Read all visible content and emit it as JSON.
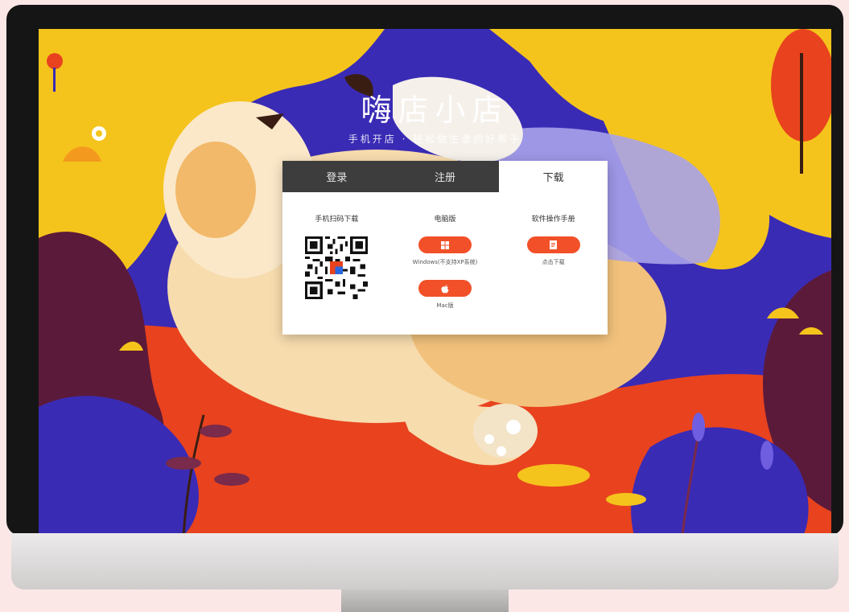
{
  "header": {
    "brand": "嗨店小店",
    "slogan": "手机开店 · 轻松做生意的好帮手"
  },
  "tabs": [
    {
      "label": "登录",
      "active": false
    },
    {
      "label": "注册",
      "active": false
    },
    {
      "label": "下载",
      "active": true
    }
  ],
  "download": {
    "mobile": {
      "title": "手机扫码下载"
    },
    "desktop": {
      "title": "电脑版",
      "windows_label": "Windows(不支持XP系统)",
      "mac_label": "Mac版"
    },
    "manual": {
      "title": "软件操作手册",
      "label": "点击下载"
    }
  },
  "colors": {
    "accent": "#f25028",
    "tab_bar": "#3d3d3d",
    "scene_blue": "#3a2bb5",
    "scene_yellow": "#f5c41c",
    "scene_red": "#e8431e"
  },
  "icons": [
    "qr-code-icon",
    "windows-icon",
    "apple-icon",
    "document-icon"
  ]
}
